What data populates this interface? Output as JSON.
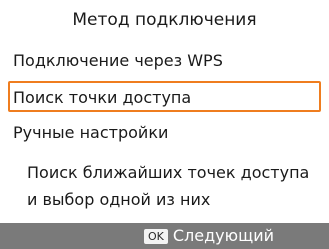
{
  "screen": {
    "title": "Метод подключения",
    "menu": {
      "items": [
        {
          "label": "Подключение через WPS",
          "selected": false
        },
        {
          "label": "Поиск точки доступа",
          "selected": true
        },
        {
          "label": "Ручные настройки",
          "selected": false
        }
      ]
    },
    "description": {
      "lines": [
        "Поиск ближайших точек доступа",
        "и выбор одной из них"
      ]
    },
    "footer": {
      "key_label": "OK",
      "action_label": "Следующий"
    },
    "colors": {
      "selection_border": "#ef7d1f",
      "footer_background": "#7a7a7a",
      "footer_text": "#ffffff"
    }
  }
}
